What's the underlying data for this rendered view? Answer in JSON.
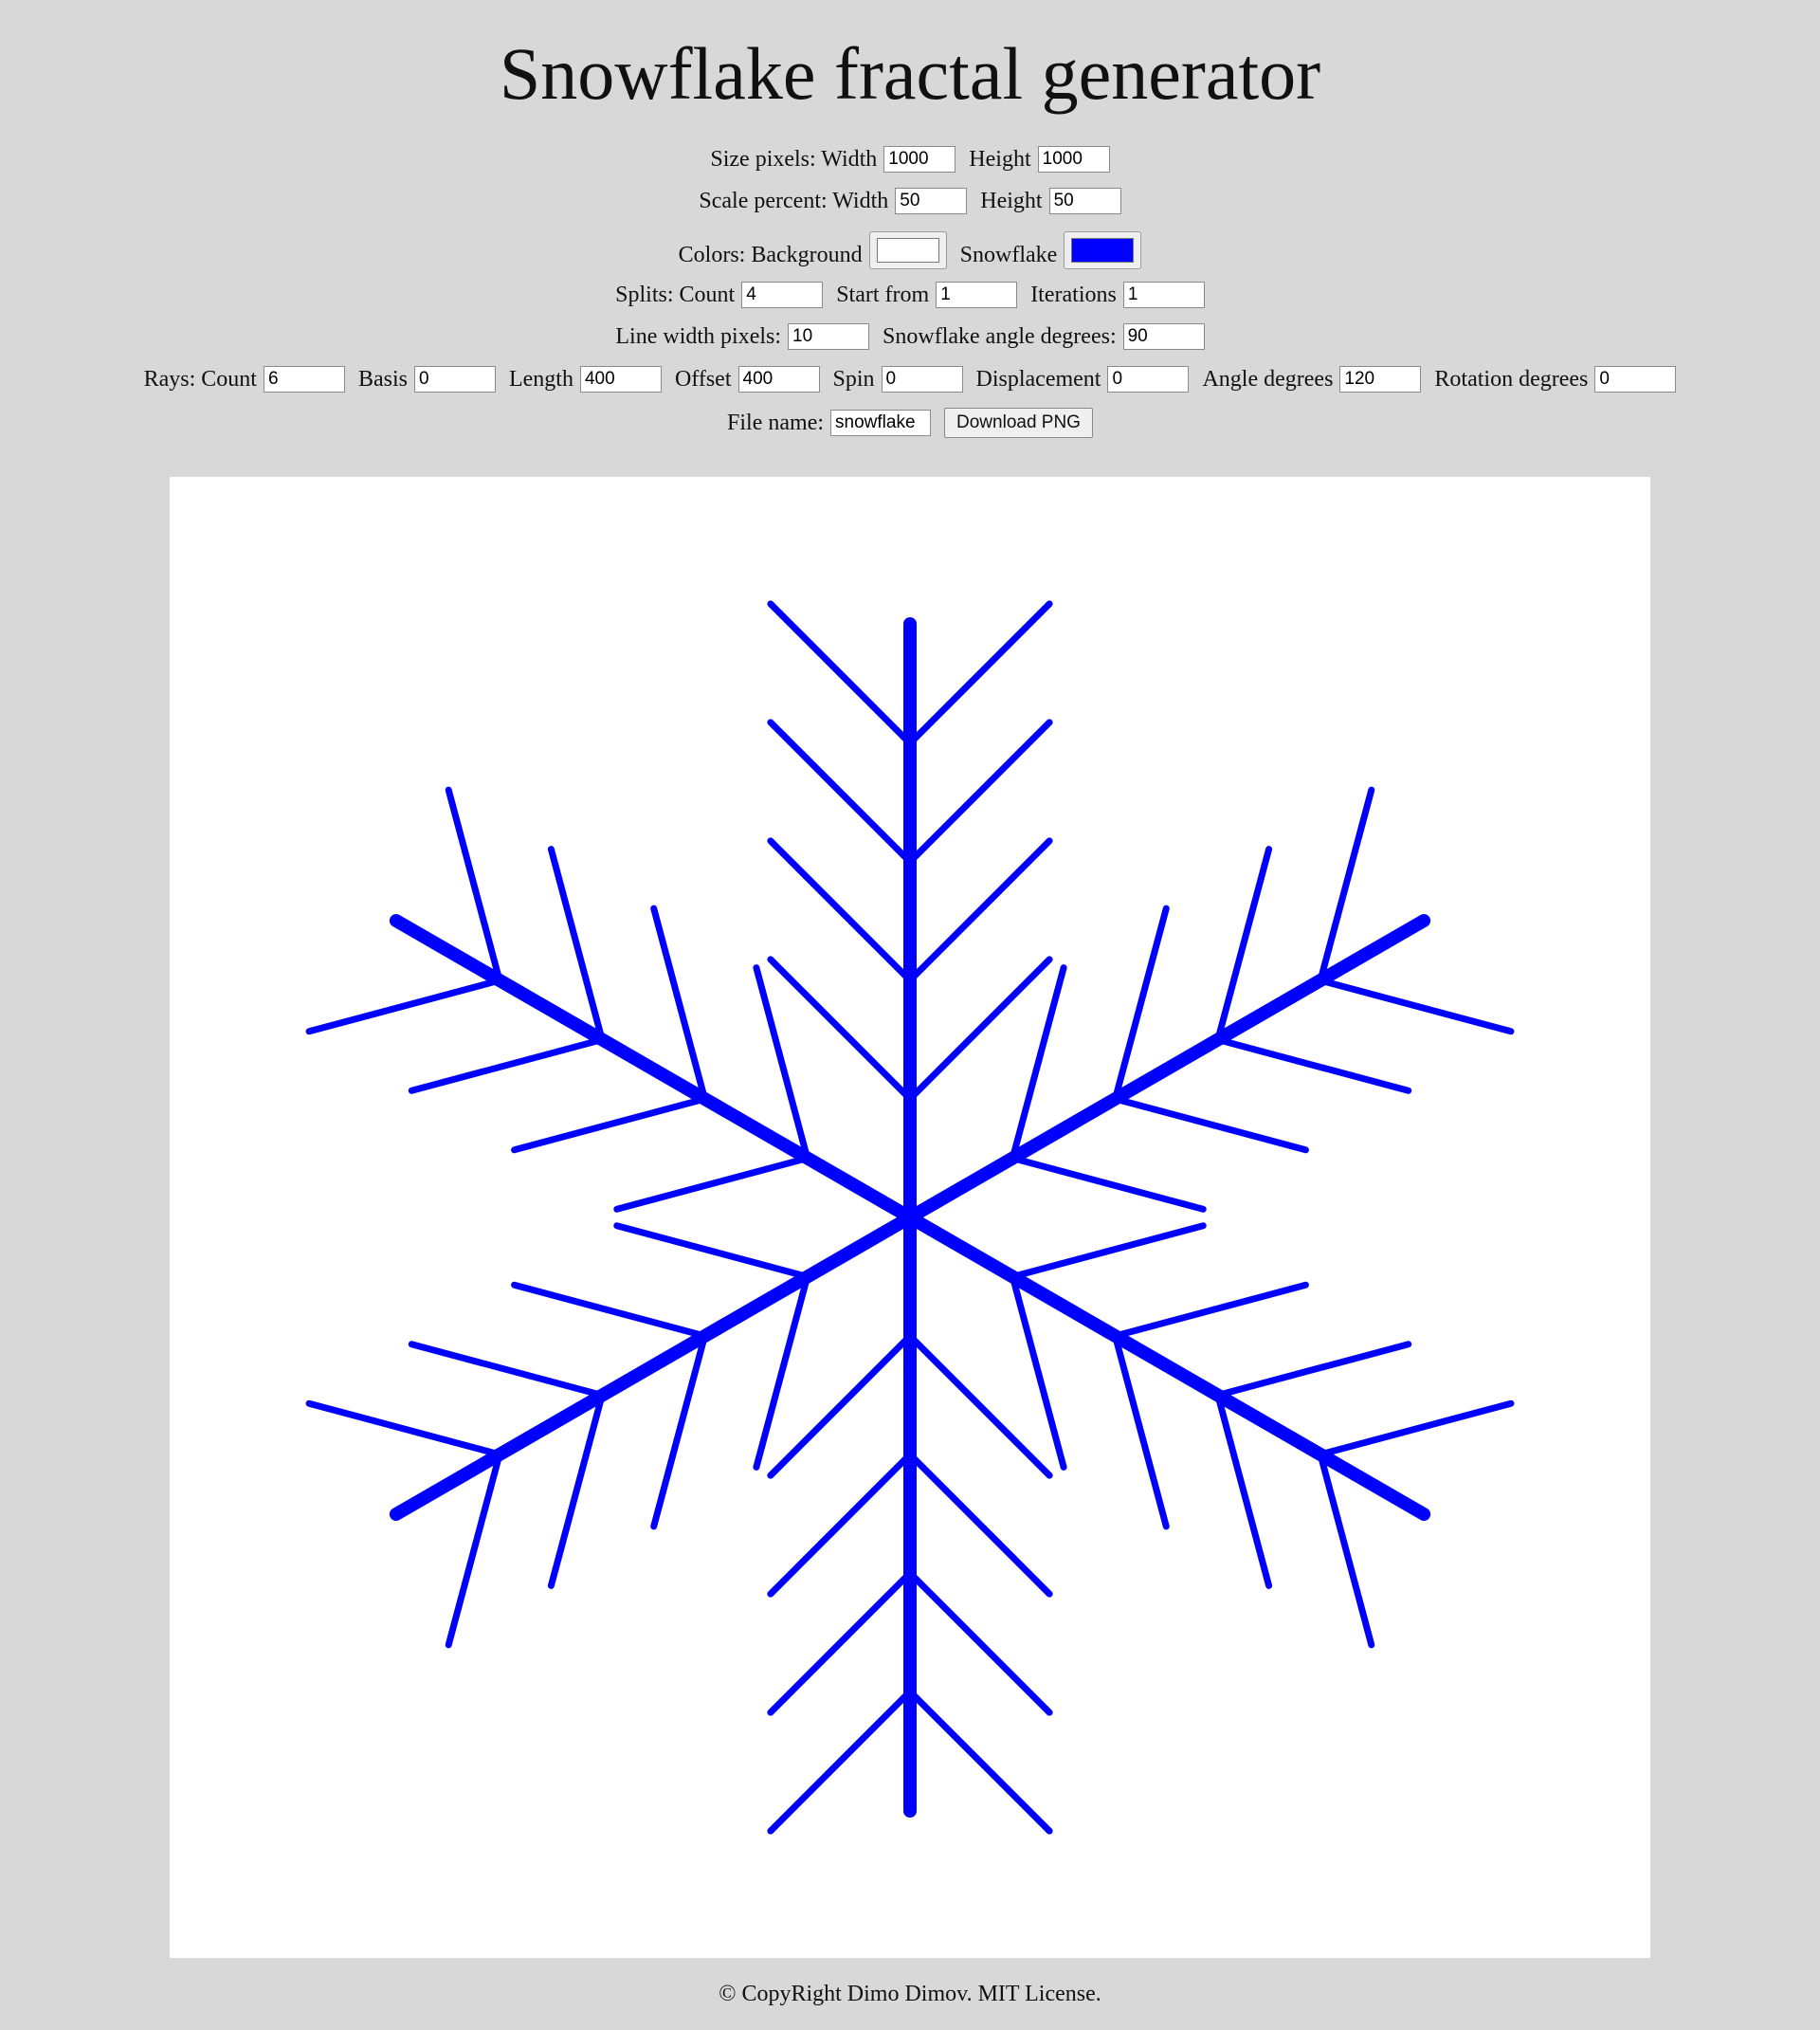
{
  "title": "Snowflake fractal generator",
  "size": {
    "label": "Size pixels: Width",
    "width": "1000",
    "height_label": "Height",
    "height": "1000"
  },
  "scale": {
    "label": "Scale percent: Width",
    "width": "50",
    "height_label": "Height",
    "height": "50"
  },
  "colors": {
    "label": "Colors: Background",
    "background": "#ffffff",
    "snowflake_label": "Snowflake",
    "snowflake": "#0000ff"
  },
  "splits": {
    "label": "Splits: Count",
    "count": "4",
    "start_label": "Start from",
    "start": "1",
    "iterations_label": "Iterations",
    "iterations": "1"
  },
  "line": {
    "label": "Line width pixels:",
    "width": "10",
    "angle_label": "Snowflake angle degrees:",
    "angle": "90"
  },
  "rays": {
    "count_label": "Rays: Count",
    "count": "6",
    "basis_label": "Basis",
    "basis": "0",
    "length_label": "Length",
    "length": "400",
    "offset_label": "Offset",
    "offset": "400",
    "spin_label": "Spin",
    "spin": "0",
    "displacement_label": "Displacement",
    "displacement": "0",
    "angle_label": "Angle degrees",
    "angle": "120",
    "rotation_label": "Rotation degrees",
    "rotation": "0"
  },
  "file": {
    "label": "File name:",
    "name": "snowflake",
    "download_label": "Download PNG"
  },
  "footer": "© CopyRight Dimo Dimov. MIT License."
}
